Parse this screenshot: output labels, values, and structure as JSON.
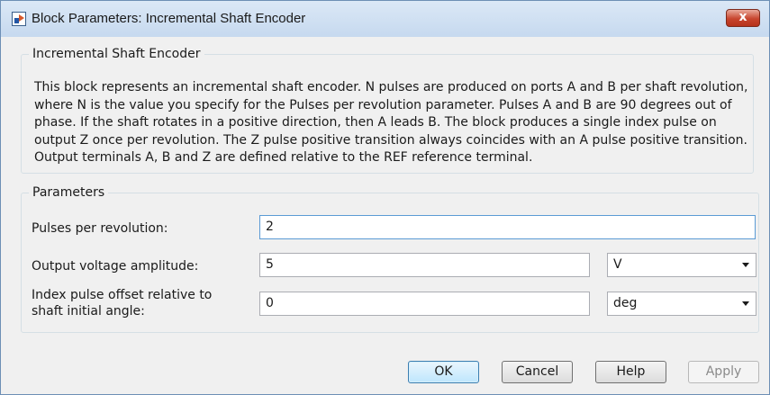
{
  "window": {
    "title": "Block Parameters: Incremental Shaft Encoder",
    "close_glyph": "x",
    "app_icon": "simulink-block-icon",
    "close_icon": "close-icon"
  },
  "description_group": {
    "title": "Incremental Shaft Encoder",
    "text": "This block represents an incremental shaft encoder. N pulses are produced on ports A and B per shaft revolution, where N is the value you specify for the Pulses per revolution parameter. Pulses A and B are 90 degrees out of phase. If the shaft rotates in a positive direction, then A leads B. The block produces a single index pulse on output Z once per revolution.  The Z pulse positive transition always coincides with an A pulse positive transition. Output terminals A, B and Z are defined relative to the REF reference terminal."
  },
  "parameters_group": {
    "title": "Parameters",
    "pulses_per_revolution": {
      "label": "Pulses per revolution:",
      "value": "2"
    },
    "output_voltage_amplitude": {
      "label": "Output voltage amplitude:",
      "value": "5",
      "unit": "V"
    },
    "index_pulse_offset": {
      "label_line1": "Index pulse offset relative to",
      "label_line2": "shaft initial angle:",
      "value": "0",
      "unit": "deg"
    }
  },
  "buttons": {
    "ok": "OK",
    "cancel": "Cancel",
    "help": "Help",
    "apply": "Apply"
  },
  "colors": {
    "ok_border": "#3c7fb1",
    "close_button": "#c7452e",
    "group_border": "#d5dfe5"
  }
}
